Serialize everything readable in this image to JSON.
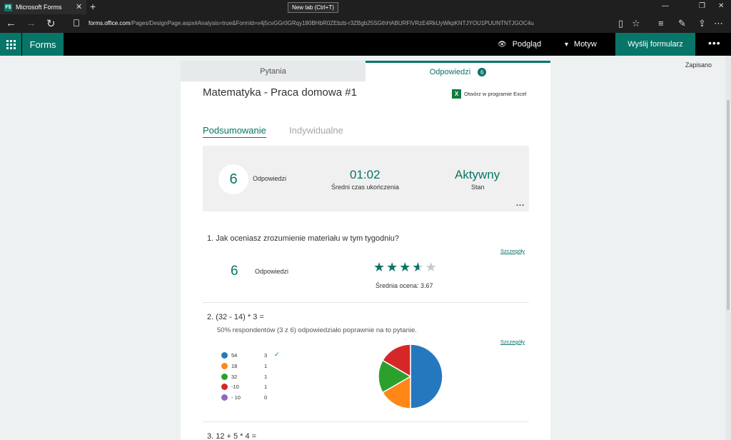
{
  "browser": {
    "tab_title": "Microsoft Forms",
    "tab_favicon": "F$",
    "tooltip": "New tab (Ctrl+T)",
    "url_host": "forms.office.com",
    "url_path": "/Pages/DesignPage.aspx#Analysis=true&FormId=v4j5cvGGr0GRqy180BHbR0ZEbzb-r3ZBgb25SGthHABURFlVRzE4RkUyWkpKNTJYOU1PUUNTNTJGOC4u"
  },
  "appbar": {
    "app_name": "Forms",
    "preview_label": "Podgląd",
    "theme_label": "Motyw",
    "send_label": "Wyślij formularz"
  },
  "status": {
    "saved": "Zapisano"
  },
  "tabs": {
    "questions": "Pytania",
    "responses": "Odpowiedzi",
    "responses_count": "6"
  },
  "form": {
    "title": "Matematyka - Praca domowa #1",
    "excel_label": "Otwórz w programie Excel",
    "excel_icon": "X"
  },
  "subtabs": {
    "summary": "Podsumowanie",
    "individual": "Indywidualne"
  },
  "stats": {
    "responses_count": "6",
    "responses_label": "Odpowiedzi",
    "avg_time": "01:02",
    "avg_time_label": "Średni czas ukończenia",
    "status": "Aktywny",
    "status_label": "Stan",
    "more": "..."
  },
  "questions": [
    {
      "title": "1.  Jak oceniasz zrozumienie materiału w tym tygodniu?",
      "details": "Szczegóły",
      "count": "6",
      "count_label": "Odpowiedzi",
      "rating": 3.67,
      "rating_max": 5,
      "rating_label": "Średnia ocena: 3.67"
    },
    {
      "title": "2.  (32 - 14) * 3 =",
      "details": "Szczegóły",
      "note": "50% respondentów (3 z 6) odpowiedziało poprawnie na to pytanie.",
      "options": [
        {
          "label": "54",
          "count": 3,
          "color": "#2678be",
          "correct": true
        },
        {
          "label": "18",
          "count": 1,
          "color": "#ff8717",
          "correct": false
        },
        {
          "label": "32",
          "count": 1,
          "color": "#2ca02c",
          "correct": false
        },
        {
          "label": "-10",
          "count": 1,
          "color": "#d62728",
          "correct": false
        },
        {
          "label": "- 10",
          "count": 0,
          "color": "#9467bd",
          "correct": false
        }
      ]
    },
    {
      "title": "3.  12 + 5 * 4 ="
    }
  ],
  "chart_data": {
    "type": "pie",
    "categories": [
      "54",
      "18",
      "32",
      "-10",
      "- 10"
    ],
    "values": [
      3,
      1,
      1,
      1,
      0
    ]
  }
}
